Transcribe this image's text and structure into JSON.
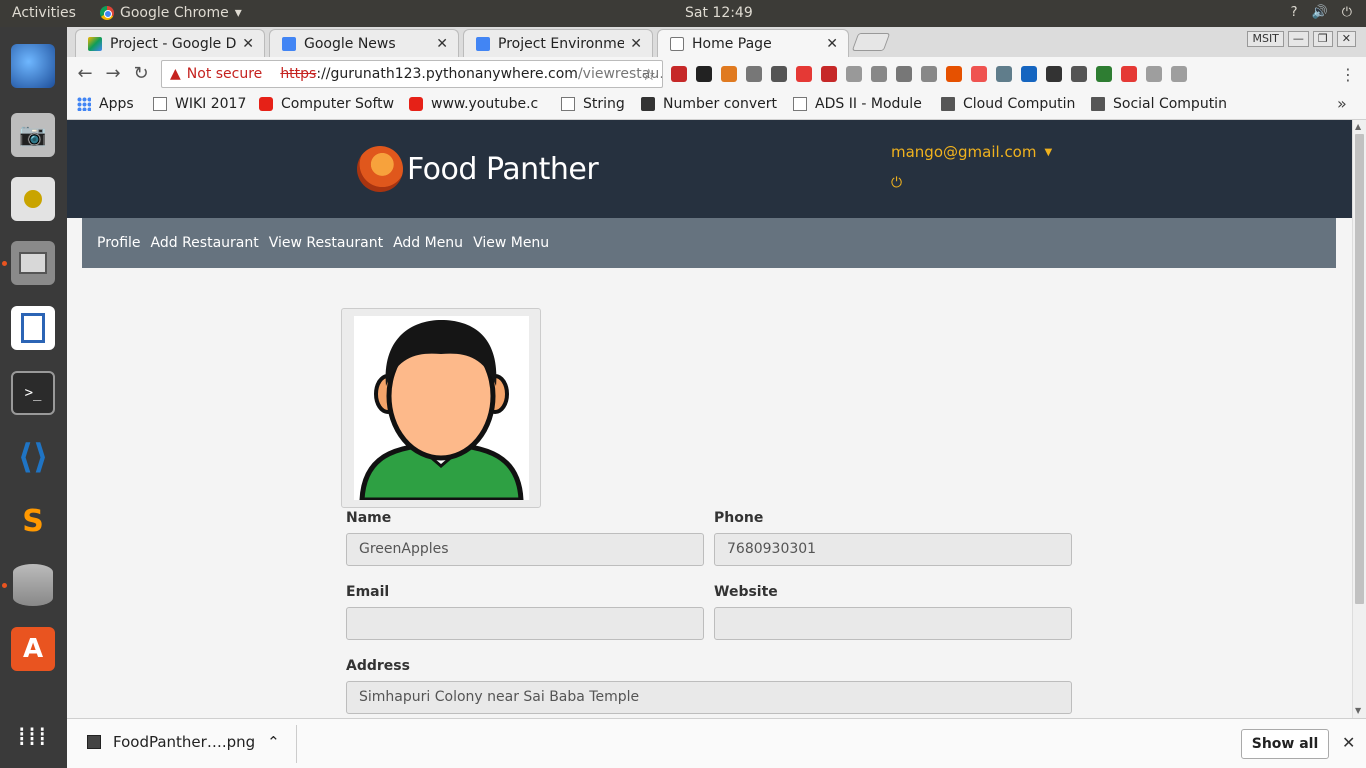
{
  "system": {
    "activities": "Activities",
    "app_name": "Google Chrome",
    "clock": "Sat 12:49",
    "tray": [
      "?",
      "🔊",
      "⏻"
    ]
  },
  "launcher": {
    "items": [
      {
        "name": "thunderbird",
        "color": "#2a6fc9"
      },
      {
        "name": "camera",
        "color": "#9a9a9a"
      },
      {
        "name": "speaker",
        "color": "#c9c9c9"
      },
      {
        "name": "files",
        "color": "#7a7a7a"
      },
      {
        "name": "writer",
        "color": "#2b64b5"
      },
      {
        "name": "terminal",
        "color": "#2b2b2b"
      },
      {
        "name": "vscode",
        "color": "#1f74c4"
      },
      {
        "name": "sublime",
        "color": "#ff8b00"
      },
      {
        "name": "database",
        "color": "#8e8e8e"
      },
      {
        "name": "software",
        "color": "#e95420"
      }
    ]
  },
  "tabs": [
    {
      "title": "Project - Google Drive",
      "icon_color": "#f4b400"
    },
    {
      "title": "Google News",
      "icon_color": "#4285f4"
    },
    {
      "title": "Project Environment",
      "icon_color": "#4285f4"
    },
    {
      "title": "Home Page",
      "icon_color": "#ffffff"
    }
  ],
  "window": {
    "profile": "MSIT",
    "minimize": "—",
    "restore": "❐",
    "close": "✕"
  },
  "omnibox": {
    "warning": "▲",
    "not_secure": "Not secure",
    "scheme": "https",
    "host": "://gurunath123.pythonanywhere.com",
    "path": "/viewrestau…",
    "star": "☆"
  },
  "extensions": [
    "#c62828",
    "#222222",
    "#e07a20",
    "#777777",
    "#555555",
    "#e53935",
    "#c62828",
    "#999999",
    "#888888",
    "#777777",
    "#888888",
    "#e65100",
    "#ef5350",
    "#607d8b",
    "#1565c0",
    "#333333",
    "#555555",
    "#2e7d32",
    "#e53935",
    "#9e9e9e",
    "#9e9e9e"
  ],
  "bookmarks": [
    {
      "label": "Apps",
      "icon_color": "#4285f4"
    },
    {
      "label": "WIKI 2017",
      "icon_color": "#bbbbbb"
    },
    {
      "label": "Computer Softw",
      "icon_color": "#e62117"
    },
    {
      "label": "www.youtube.c",
      "icon_color": "#e62117"
    },
    {
      "label": "String",
      "icon_color": "#bbbbbb"
    },
    {
      "label": "Number convert",
      "icon_color": "#333333"
    },
    {
      "label": "ADS II - Module",
      "icon_color": "#bbbbbb"
    },
    {
      "label": "Cloud Computin",
      "icon_color": "#555555"
    },
    {
      "label": "Social Computin",
      "icon_color": "#555555"
    }
  ],
  "site": {
    "brand": "Food Panther",
    "user_email": "mango@gmail.com",
    "power_icon": "⏻",
    "nav": [
      "Profile",
      "Add Restaurant",
      "View Restaurant",
      "Add Menu",
      "View Menu"
    ]
  },
  "form": {
    "name_label": "Name",
    "name_value": "GreenApples",
    "phone_label": "Phone",
    "phone_value": "7680930301",
    "email_label": "Email",
    "email_value": "",
    "website_label": "Website",
    "website_value": "",
    "address_label": "Address",
    "address_value": "Simhapuri Colony near Sai Baba Temple"
  },
  "downloads": {
    "file": "FoodPanther….png",
    "show_all": "Show all",
    "close": "✕"
  }
}
